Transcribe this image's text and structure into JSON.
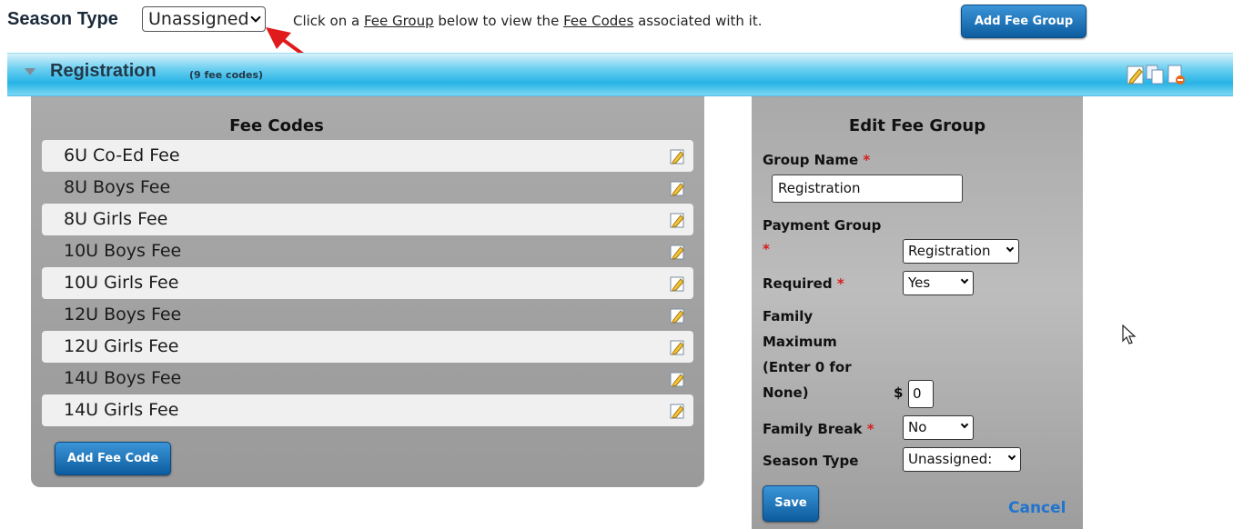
{
  "topbar": {
    "season_type_label": "Season Type",
    "season_type_value": "Unassigned",
    "hint_prefix": "Click on a ",
    "hint_link1": "Fee Group",
    "hint_middle": " below to view the ",
    "hint_link2": "Fee Codes",
    "hint_suffix": " associated with it.",
    "add_fee_group_label": "Add Fee Group"
  },
  "group": {
    "title": "Registration",
    "count": "(9 fee codes)",
    "actions": [
      "edit-icon",
      "copy-icon",
      "delete-icon"
    ]
  },
  "fee_codes": {
    "title": "Fee Codes",
    "items": [
      "6U Co-Ed Fee",
      "8U Boys Fee",
      "8U Girls Fee",
      "10U Boys Fee",
      "10U Girls Fee",
      "12U Boys Fee",
      "12U Girls Fee",
      "14U Boys Fee",
      "14U Girls Fee"
    ],
    "add_label": "Add Fee Code"
  },
  "edit_group": {
    "title": "Edit Fee Group",
    "group_name_label": "Group Name",
    "group_name_value": "Registration",
    "payment_group_label": "Payment Group",
    "payment_group_value": "Registration",
    "required_label": "Required",
    "required_value": "Yes",
    "family_max_lines": [
      "Family",
      "Maximum",
      "(Enter 0 for",
      "None)"
    ],
    "currency_symbol": "$",
    "family_max_value": "0",
    "family_break_label": "Family Break",
    "family_break_value": "No",
    "season_type_label": "Season Type",
    "season_type_value": "Unassigned:",
    "required_marker": "*",
    "save_label": "Save",
    "cancel_label": "Cancel"
  },
  "colors": {
    "bar_blue": "#27b4e6",
    "button_blue": "#0c5d9f",
    "required_red": "#d61d1d",
    "link_blue": "#1f74cf",
    "annotation_arrow": "#e01b1b"
  }
}
